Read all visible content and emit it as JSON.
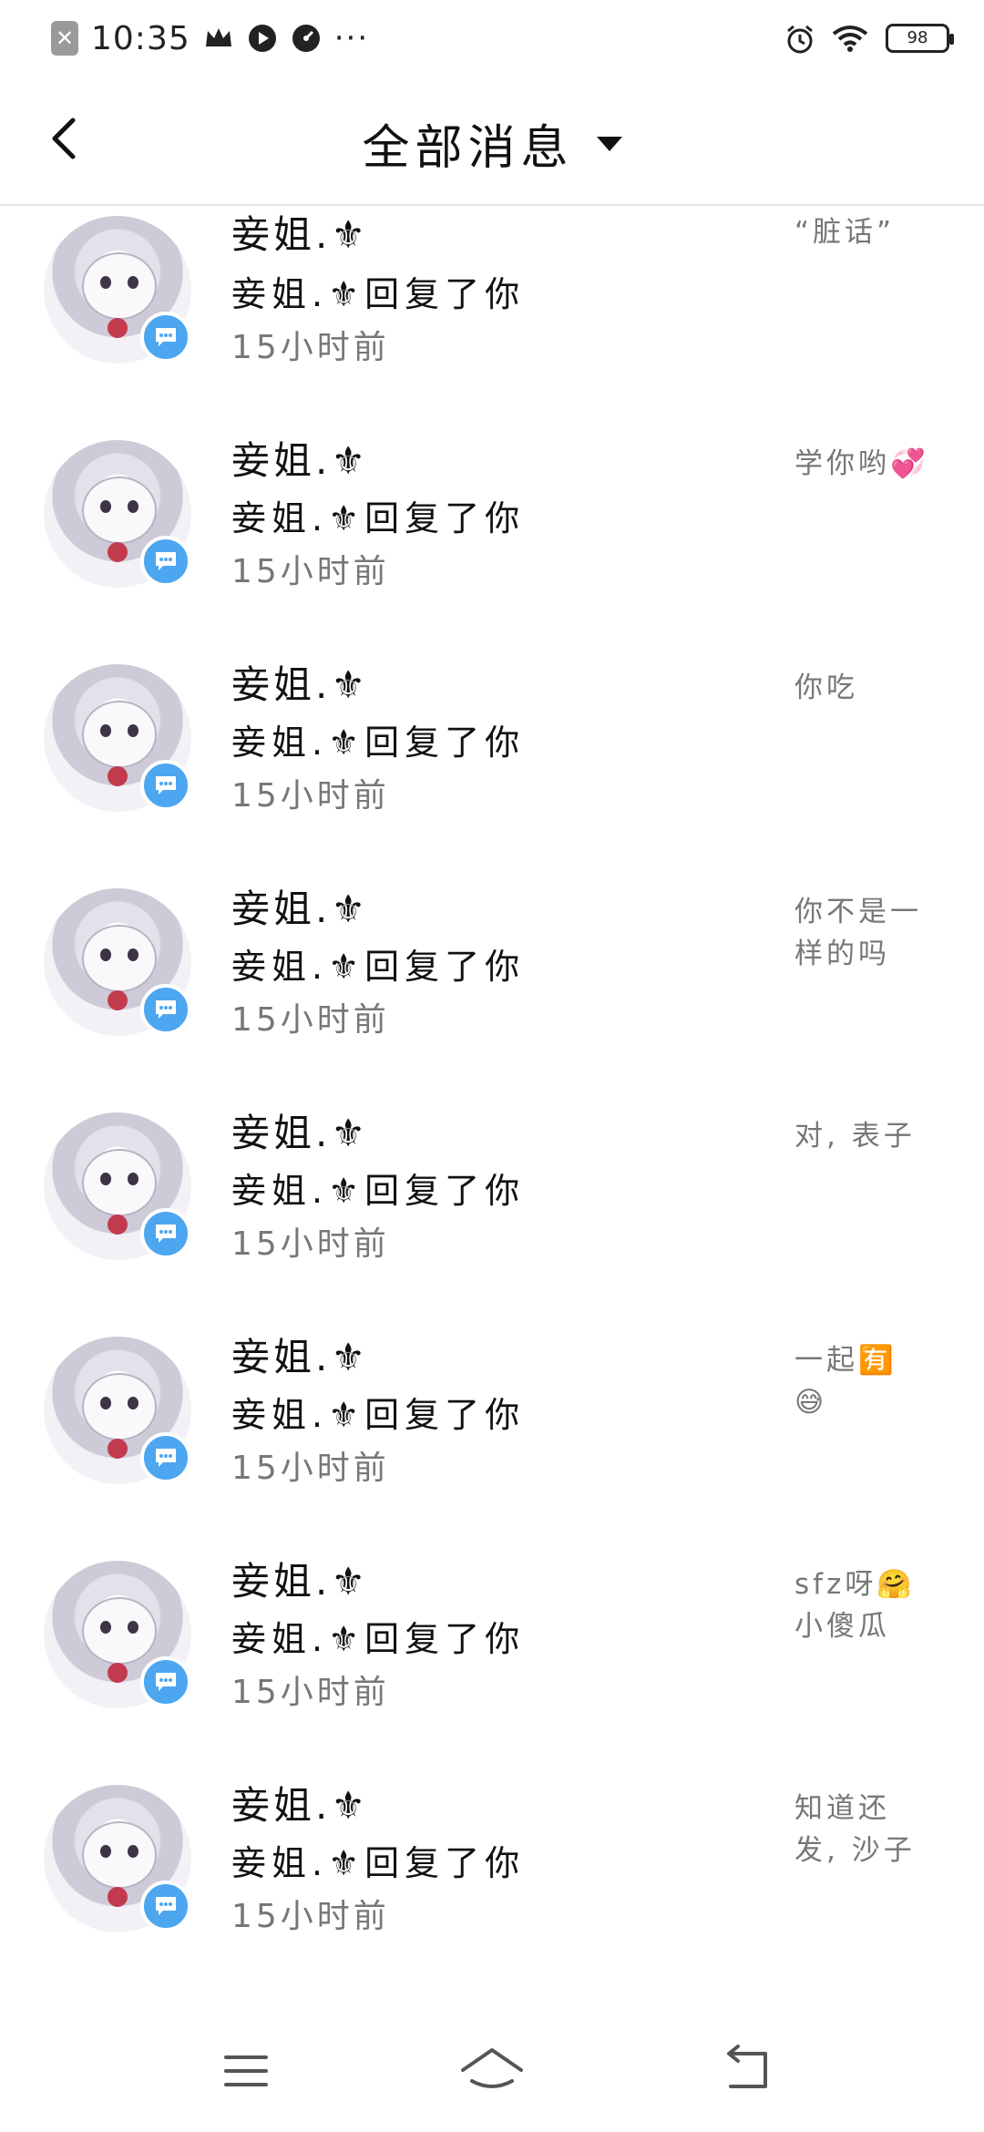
{
  "status_bar": {
    "time": "10:35",
    "notify_icon": "x-notification-icon",
    "icons": [
      "crown-icon",
      "play-icon",
      "speed-icon"
    ],
    "more": "···",
    "battery": "98",
    "right_icons": [
      "alarm-icon",
      "wifi-icon",
      "battery-icon"
    ]
  },
  "header": {
    "title": "全部消息",
    "back_icon": "back-chevron-icon",
    "dropdown_icon": "caret-down-icon"
  },
  "messages": [
    {
      "name": "妾姐.⚜",
      "action": "妾姐.⚜回复了你",
      "time": "15小时前",
      "preview": "“脏话”"
    },
    {
      "name": "妾姐.⚜",
      "action": "妾姐.⚜回复了你",
      "time": "15小时前",
      "preview": "学你哟💞"
    },
    {
      "name": "妾姐.⚜",
      "action": "妾姐.⚜回复了你",
      "time": "15小时前",
      "preview": "你吃"
    },
    {
      "name": "妾姐.⚜",
      "action": "妾姐.⚜回复了你",
      "time": "15小时前",
      "preview": "你不是一\n样的吗"
    },
    {
      "name": "妾姐.⚜",
      "action": "妾姐.⚜回复了你",
      "time": "15小时前",
      "preview": "对, 表子"
    },
    {
      "name": "妾姐.⚜",
      "action": "妾姐.⚜回复了你",
      "time": "15小时前",
      "preview": "一起🈶\n😅"
    },
    {
      "name": "妾姐.⚜",
      "action": "妾姐.⚜回复了你",
      "time": "15小时前",
      "preview": "sfz呀🤗\n小傻瓜"
    },
    {
      "name": "妾姐.⚜",
      "action": "妾姐.⚜回复了你",
      "time": "15小时前",
      "preview": "知道还\n发, 沙子"
    }
  ],
  "nav": {
    "menu_icon": "menu-icon",
    "home_icon": "home-icon",
    "back_icon": "return-icon"
  },
  "colors": {
    "badge": "#4da6f0",
    "secondary_text": "#777777",
    "divider": "#e6e6e6"
  }
}
